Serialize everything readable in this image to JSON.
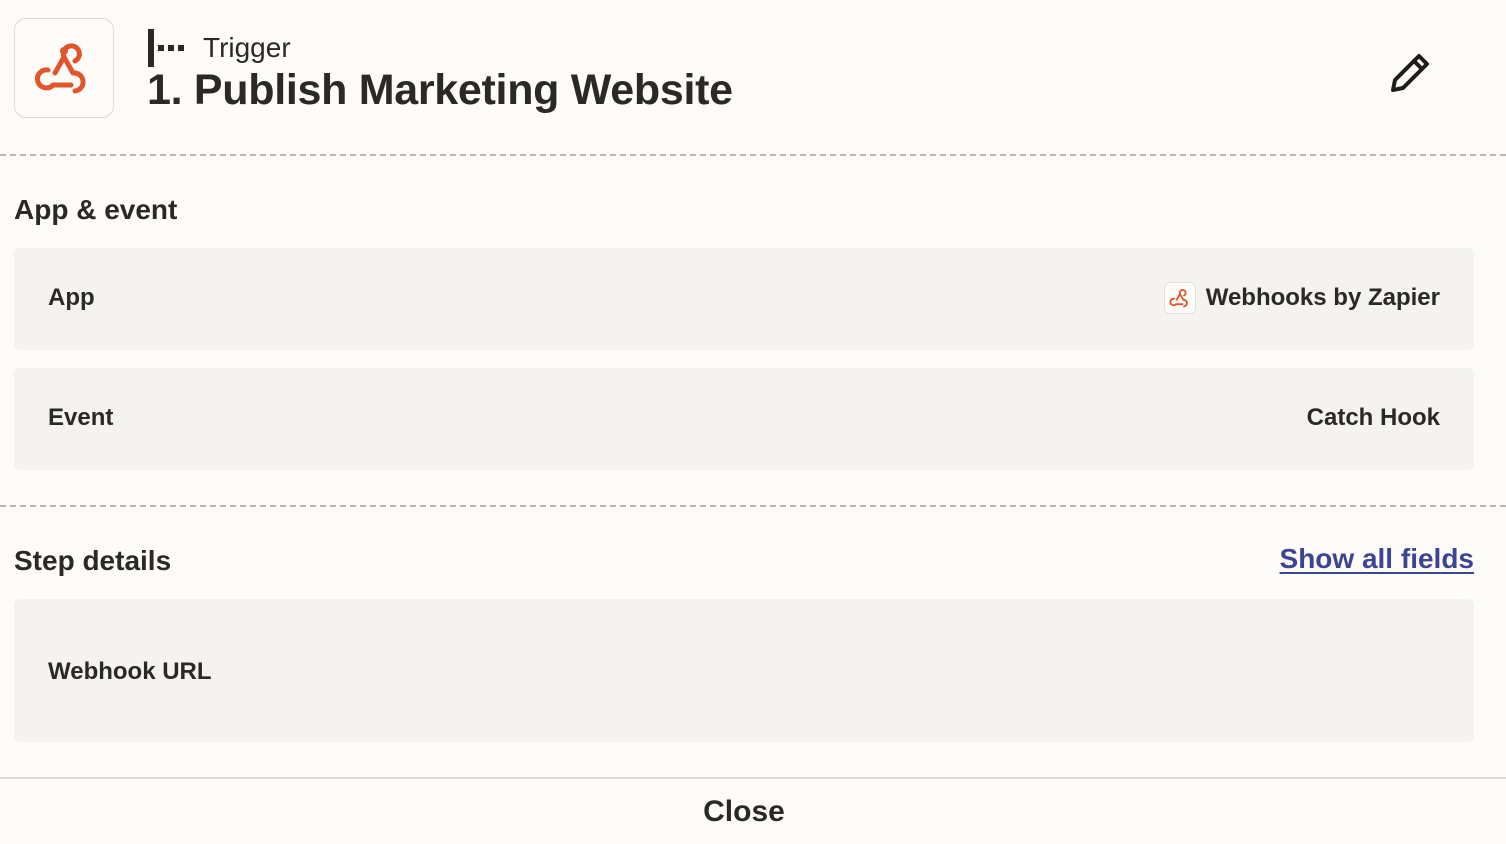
{
  "header": {
    "step_type": "Trigger",
    "title": "1. Publish Marketing Website",
    "app_icon": "webhook-icon",
    "step_type_icon": "trigger-step-icon",
    "edit_icon": "pencil-icon"
  },
  "app_event": {
    "section_title": "App & event",
    "rows": [
      {
        "label": "App",
        "value": "Webhooks by Zapier",
        "icon": "webhook-icon"
      },
      {
        "label": "Event",
        "value": "Catch Hook"
      }
    ]
  },
  "step_details": {
    "section_title": "Step details",
    "show_all_label": "Show all fields",
    "fields": [
      {
        "label": "Webhook URL",
        "value": ""
      }
    ]
  },
  "footer": {
    "close_label": "Close"
  },
  "colors": {
    "brand_orange": "#e0552c",
    "link_blue": "#3d4592",
    "background": "#fdfcf9",
    "row_background": "#f4f3f0"
  }
}
